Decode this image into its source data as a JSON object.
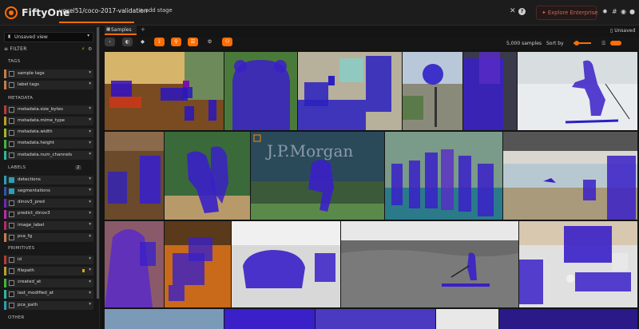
{
  "topbar": {
    "app_name": "FiftyOne",
    "dataset": "voxel51/coco-2017-validation",
    "add_stage": "+ add stage",
    "close": "✕",
    "help": "?",
    "explore": "Explore Enterprise"
  },
  "sidebar": {
    "view_select": "Unsaved view",
    "filter_label": "FILTER",
    "sections": {
      "tags": "TAGS",
      "metadata": "METADATA",
      "labels": "LABELS",
      "primitives": "PRIMITIVES",
      "other": "OTHER"
    },
    "labels_count": "2",
    "tags": [
      {
        "label": "sample tags",
        "color": "#c77d45"
      },
      {
        "label": "label tags",
        "color": "#c77d45"
      }
    ],
    "metadata": [
      {
        "label": "metadata.size_bytes",
        "color": "#b83b3b"
      },
      {
        "label": "metadata.mime_type",
        "color": "#b8a02b"
      },
      {
        "label": "metadata.width",
        "color": "#a0b82b"
      },
      {
        "label": "metadata.height",
        "color": "#3bb83b"
      },
      {
        "label": "metadata.num_channels",
        "color": "#2bb8a0"
      }
    ],
    "labels": [
      {
        "label": "detections",
        "color": "#2b9fb8"
      },
      {
        "label": "segmentations",
        "color": "#2b55b8"
      },
      {
        "label": "dinov3_pred",
        "color": "#6a2bb8"
      },
      {
        "label": "predict_dinov3",
        "color": "#b82bb0"
      },
      {
        "label": "image_label",
        "color": "#b82b6a"
      },
      {
        "label": "pca_fg",
        "color": "#c77d45"
      }
    ],
    "primitives": [
      {
        "label": "id",
        "color": "#b83b3b"
      },
      {
        "label": "filepath",
        "color": "#b8a02b"
      },
      {
        "label": "created_at",
        "color": "#3bb83b"
      },
      {
        "label": "last_modified_at",
        "color": "#2bb8a0"
      },
      {
        "label": "pca_path",
        "color": "#2b9fb8"
      }
    ]
  },
  "tabs": {
    "samples": "Samples",
    "add": "+",
    "status": "Unsaved"
  },
  "toolbar": {
    "sample_count": "5,000 samples",
    "sort_by": "Sort by"
  },
  "grid": {
    "banner_text": "J.P.Morgan",
    "icons": {
      "back": "chevron-left-icon",
      "palette": "palette-icon",
      "tag": "tag-icon",
      "filter": "filter-icon",
      "search": "search-icon",
      "list": "list-icon",
      "settings": "gear-icon",
      "person": "person-icon"
    }
  }
}
